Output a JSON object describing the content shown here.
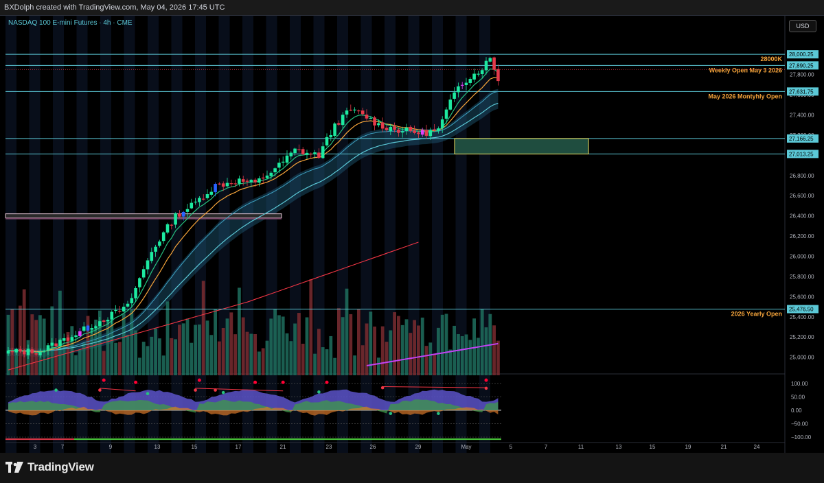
{
  "header": {
    "title": "BXDolph created with TradingView.com, May 04, 2026 17:45 UTC"
  },
  "symbol": {
    "title": "NASDAQ 100 E-mini Futures · 4h · CME"
  },
  "currency": "USD",
  "brand": {
    "name": "TradingView"
  },
  "colors": {
    "up": "#1de9a0",
    "down": "#e53a4a",
    "blue_candle": "#2962ff",
    "magenta_candle": "#e040fb",
    "level_line": "#5bc8d6",
    "level_text": "#f7a53b",
    "ema_fast": "#26c281",
    "ema_slow": "#f7a53b",
    "sma_long": "#f23645",
    "volume_ma": "#c342f5",
    "background": "#000000"
  },
  "chart_data": {
    "type": "candlestick",
    "price_range": [
      24950,
      28110
    ],
    "price_axis_ticks": [
      25000,
      25200,
      25400,
      25600,
      25800,
      26000,
      26200,
      26400,
      26600,
      26800,
      27000,
      27200,
      27400,
      27600,
      27800,
      28000
    ],
    "price_tags": [
      {
        "label": "28,000.25",
        "value": 28000.25
      },
      {
        "label": "27,890.25",
        "value": 27890.25
      },
      {
        "label": "27,631.75",
        "value": 27631.75
      },
      {
        "label": "27,166.25",
        "value": 27166.25
      },
      {
        "label": "27,013.25",
        "value": 27013.25
      },
      {
        "label": "25,476.50",
        "value": 25476.5
      }
    ],
    "levels": [
      {
        "label": "28000K",
        "value": 28000.25
      },
      {
        "label": "Weekly Open May 3 2026",
        "value": 27890.25
      },
      {
        "label": "May 2026 Montyhly Open",
        "value": 27631.75
      },
      {
        "label": "",
        "value": 27166.25
      },
      {
        "label": "",
        "value": 27013.25
      },
      {
        "label": "2026 Yearly Open",
        "value": 25476.5
      }
    ],
    "date_axis": [
      "3",
      "7",
      "9",
      "13",
      "15",
      "17",
      "21",
      "23",
      "26",
      "29",
      "May",
      "5",
      "7",
      "11",
      "13",
      "15",
      "19",
      "21",
      "24"
    ],
    "oscillator_ticks": [
      "100.00",
      "50.00",
      "0.00",
      "−50.00",
      "−100.00"
    ],
    "oscillator_range": [
      -110,
      120
    ],
    "anchors": [
      [
        0,
        25050
      ],
      [
        8,
        25060
      ],
      [
        18,
        25250
      ],
      [
        25,
        25400
      ],
      [
        30,
        25500
      ],
      [
        36,
        26050
      ],
      [
        42,
        26400
      ],
      [
        46,
        26500
      ],
      [
        52,
        26700
      ],
      [
        58,
        26750
      ],
      [
        62,
        26720
      ],
      [
        68,
        26900
      ],
      [
        72,
        27050
      ],
      [
        78,
        27000
      ],
      [
        82,
        27300
      ],
      [
        86,
        27450
      ],
      [
        90,
        27380
      ],
      [
        93,
        27300
      ],
      [
        98,
        27250
      ],
      [
        104,
        27220
      ],
      [
        108,
        27250
      ],
      [
        113,
        27700
      ],
      [
        118,
        27830
      ],
      [
        121,
        27960
      ],
      [
        123,
        27760
      ]
    ]
  }
}
